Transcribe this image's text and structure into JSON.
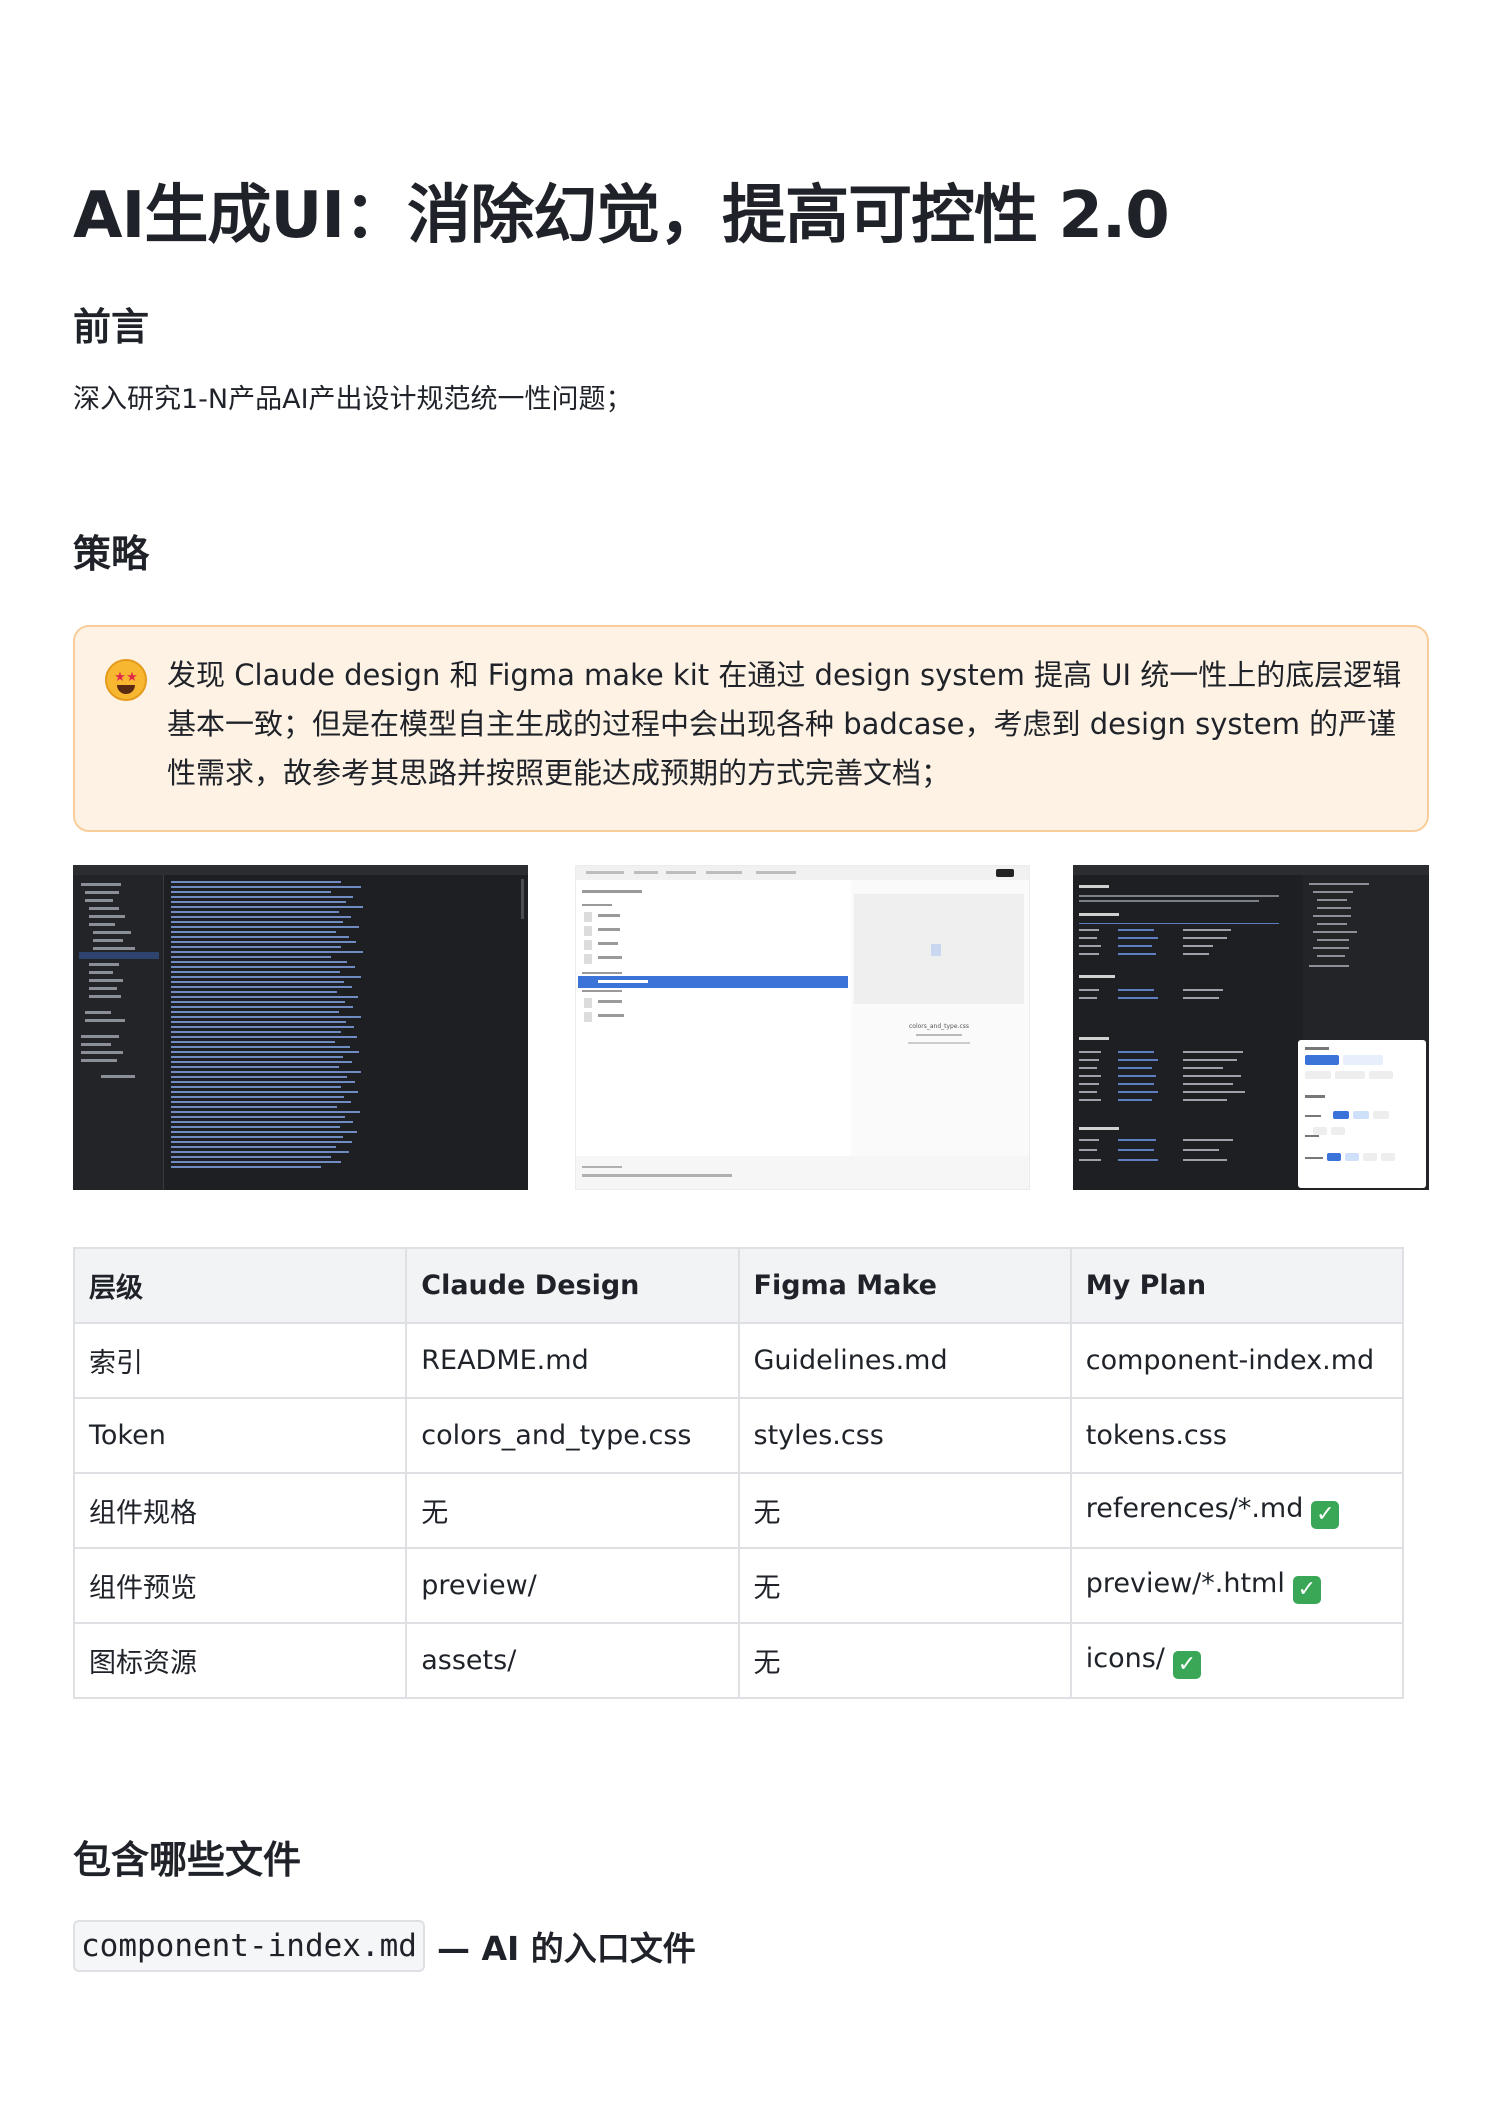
{
  "page": {
    "title": "AI生成UI：消除幻觉，提高可控性 2.0"
  },
  "preface": {
    "heading": "前言",
    "text": "深入研究1-N产品AI产出设计规范统一性问题；"
  },
  "strategy": {
    "heading": "策略",
    "callout_icon": "star-struck-emoji-icon",
    "callout_text": "发现 Claude design 和 Figma make kit 在通过 design system 提高 UI 统一性上的底层逻辑基本一致；但是在模型自主生成的过程中会出现各种 badcase，考虑到 design system 的严谨性需求，故参考其思路并按照更能达成预期的方式完善文档；"
  },
  "screenshots": {
    "items": [
      {
        "name": "code-editor-screenshot",
        "theme": "dark"
      },
      {
        "name": "design-system-files-screenshot",
        "theme": "light",
        "caption": "colors_and_type.css"
      },
      {
        "name": "component-index-screenshot",
        "theme": "dark"
      }
    ]
  },
  "comparison_table": {
    "headers": [
      "层级",
      "Claude Design",
      "Figma Make",
      "My Plan"
    ],
    "rows": [
      {
        "cells": [
          "索引",
          "README.md",
          "Guidelines.md",
          "component-index.md"
        ],
        "check": false
      },
      {
        "cells": [
          "Token",
          "colors_and_type.css",
          "styles.css",
          "tokens.css"
        ],
        "check": false
      },
      {
        "cells": [
          "组件规格",
          "无",
          "无",
          "references/*.md"
        ],
        "check": true
      },
      {
        "cells": [
          "组件预览",
          "preview/",
          "无",
          "preview/*.html"
        ],
        "check": true
      },
      {
        "cells": [
          "图标资源",
          "assets/",
          "无",
          "icons/"
        ],
        "check": true
      }
    ],
    "check_icon": "check-mark-button-icon",
    "check_color": "#3aa757"
  },
  "files_section": {
    "heading": "包含哪些文件",
    "code": "component-index.md",
    "description": "— AI 的入口文件"
  },
  "colors": {
    "callout_bg": "#fef2e4",
    "callout_border": "#f8cd9b",
    "table_header_bg": "#f2f3f5",
    "text": "#1f2329"
  }
}
